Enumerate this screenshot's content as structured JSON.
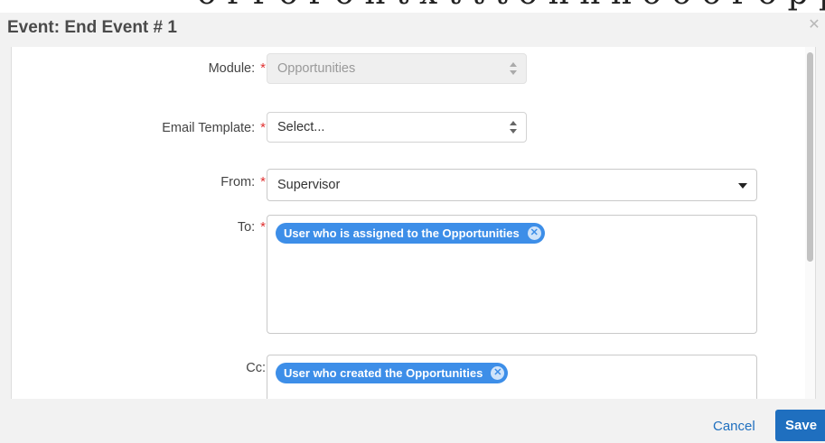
{
  "background_page": {
    "cut_text": "o r r o r o n t x t t t o n n n o o o r o p p p o o e r t"
  },
  "modal": {
    "title": "Event: End Event # 1",
    "close_icon": "close-icon"
  },
  "form": {
    "module": {
      "label": "Module:",
      "required_mark": "*",
      "value": "Opportunities",
      "disabled": true
    },
    "email_template": {
      "label": "Email Template:",
      "required_mark": "*",
      "value": "Select..."
    },
    "from": {
      "label": "From:",
      "required_mark": "*",
      "value": "Supervisor"
    },
    "to": {
      "label": "To:",
      "required_mark": "*",
      "chips": [
        {
          "label": "User who is assigned to the Opportunities"
        }
      ]
    },
    "cc": {
      "label": "Cc:",
      "chips": [
        {
          "label": "User who created the Opportunities"
        }
      ]
    }
  },
  "footer": {
    "cancel_label": "Cancel",
    "save_label": "Save"
  },
  "colors": {
    "accent": "#1f6fbf",
    "chip": "#3d8ee8",
    "required": "#e03131",
    "panel_bg": "#f2f2f2"
  }
}
